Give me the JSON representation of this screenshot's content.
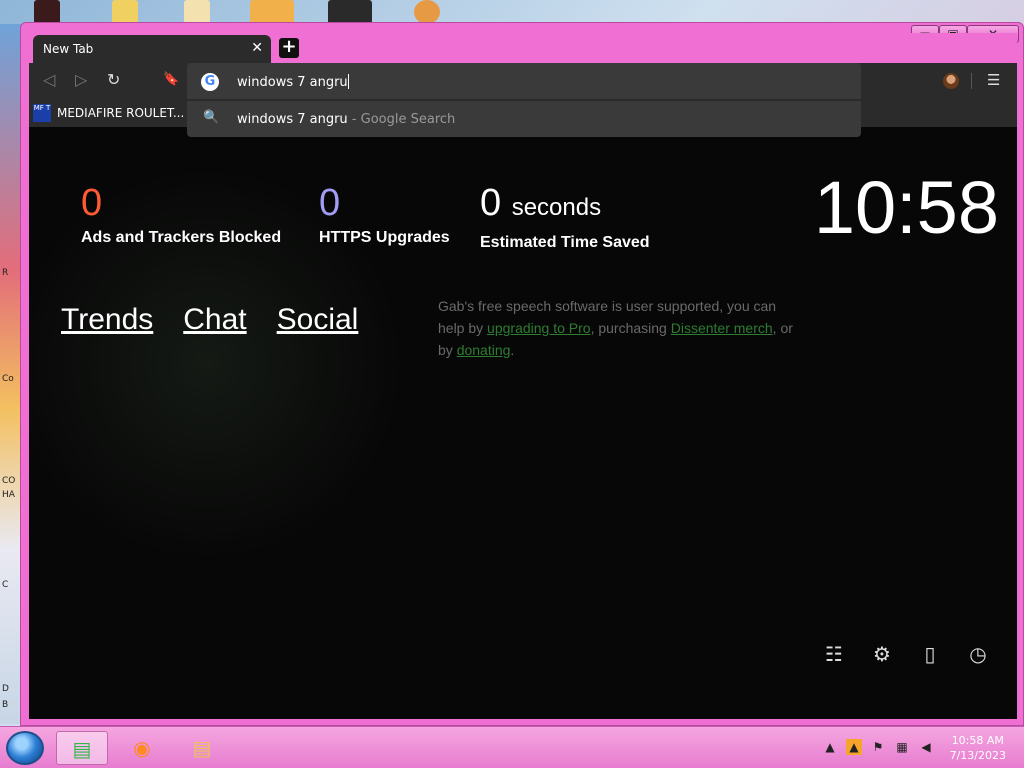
{
  "desktop": {
    "side_labels": [
      "R",
      "Co",
      "CO",
      "HA",
      "C",
      "D",
      "B"
    ]
  },
  "tab": {
    "title": "New Tab",
    "close": "✕"
  },
  "toolbar": {
    "back": "◁",
    "forward": "▷",
    "reload": "↻",
    "bookmark": "🔖",
    "menu": "☰"
  },
  "omnibox": {
    "value": "windows 7 angru",
    "suggestion": {
      "query": "windows 7 angru",
      "suffix": " - Google Search"
    }
  },
  "bookmarks": [
    {
      "label": "MEDIAFIRE ROULET...",
      "icon": "MF T"
    }
  ],
  "ntp": {
    "stats": [
      {
        "value": "0",
        "label": "Ads and Trackers Blocked",
        "color": "#ff5a36"
      },
      {
        "value": "0",
        "label": "HTTPS Upgrades",
        "color": "#a29cf4"
      },
      {
        "value": "0",
        "unit": "seconds",
        "label": "Estimated Time Saved",
        "color": "#ffffff"
      }
    ],
    "clock": "10:58",
    "links": [
      "Trends",
      "Chat",
      "Social"
    ],
    "gab": {
      "line1": "Gab's free speech software is user supported, you can help by ",
      "link1": "upgrading to Pro",
      "line2": ", purchasing ",
      "link2": "Dissenter merch",
      "line3": ", or by ",
      "link3": "donating",
      "end": "."
    },
    "tools": [
      "sliders-icon",
      "gear-icon",
      "bookmark-icon",
      "history-icon"
    ]
  },
  "taskbar": {
    "time": "10:58 AM",
    "date": "7/13/2023"
  }
}
